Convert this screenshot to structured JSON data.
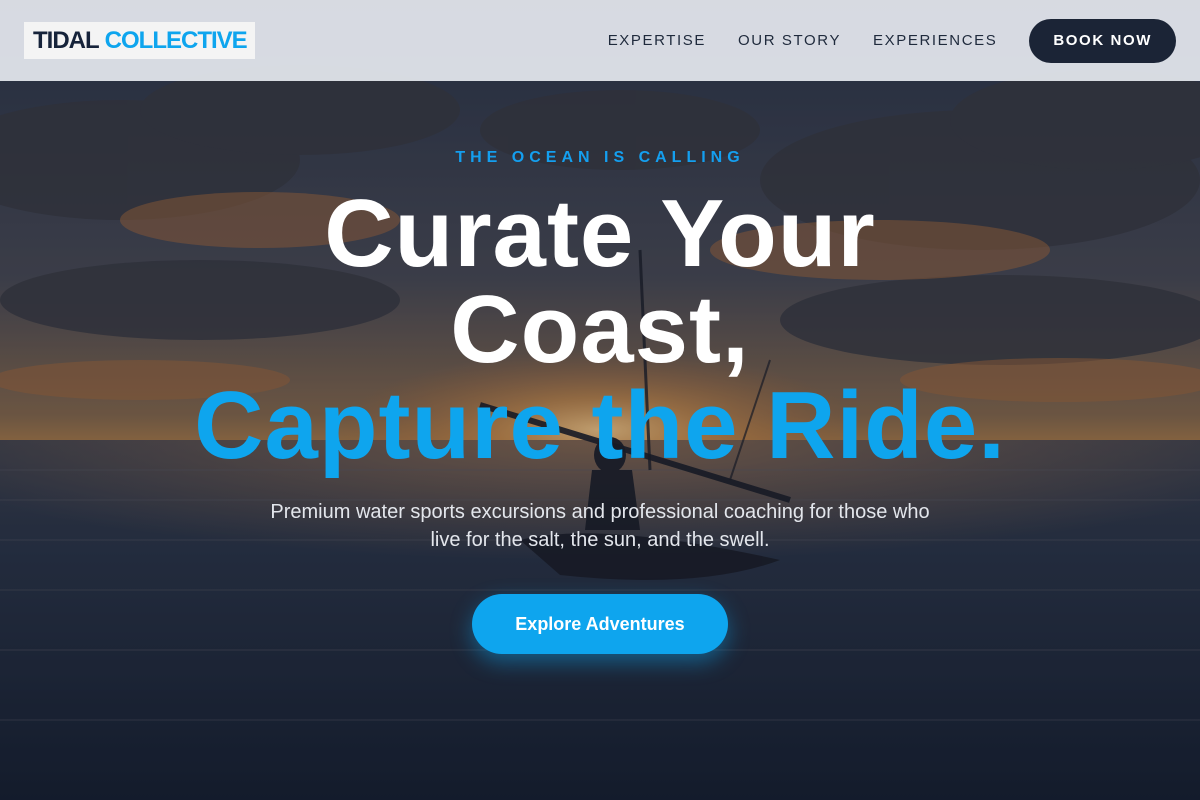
{
  "header": {
    "logo_part1": "TIDAL",
    "logo_part2": "COLLECTIVE",
    "nav": [
      {
        "label": "EXPERTISE"
      },
      {
        "label": "OUR STORY"
      },
      {
        "label": "EXPERIENCES"
      }
    ],
    "cta_label": "BOOK NOW"
  },
  "hero": {
    "eyebrow": "THE OCEAN IS CALLING",
    "headline_line1": "Curate Your",
    "headline_line2": "Coast,",
    "headline_line3": "Capture the Ride.",
    "subtext": "Premium water sports excursions and professional coaching for those who live for the salt, the sun, and the swell.",
    "cta_label": "Explore Adventures"
  },
  "colors": {
    "accent": "#0ea5ee",
    "dark": "#1b2436",
    "header_bg": "#e2e6ec"
  },
  "icons": {
    "background": "ocean-sunset-kayak-photo"
  }
}
